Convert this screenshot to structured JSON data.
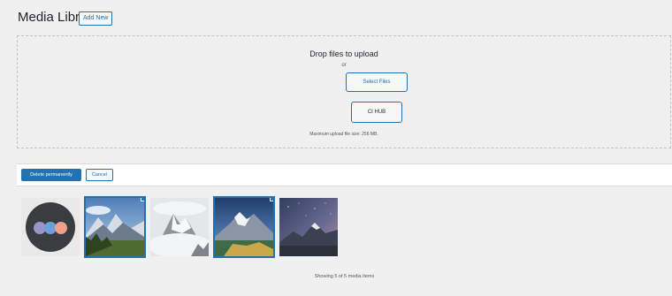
{
  "header": {
    "title": "Media Library",
    "add_new_label": "Add New"
  },
  "uploader": {
    "drop_title": "Drop files to upload",
    "or_text": "or",
    "select_files_label": "Select Files",
    "ci_hub_label": "CI HUB",
    "max_upload_text": "Maximum upload file size: 256 MB."
  },
  "bulk_toolbar": {
    "delete_label": "Delete permanently",
    "cancel_label": "Cancel"
  },
  "media_items": [
    {
      "kind": "icon-circles",
      "selected": false
    },
    {
      "kind": "mountain-valley",
      "selected": true
    },
    {
      "kind": "snowy-peaks",
      "selected": false
    },
    {
      "kind": "alpine-lake",
      "selected": true
    },
    {
      "kind": "starry-mountain",
      "selected": false
    }
  ],
  "status": {
    "count_text": "Showing 5 of 5 media items"
  },
  "colors": {
    "accent": "#2271b1",
    "background": "#f0f0f1"
  }
}
